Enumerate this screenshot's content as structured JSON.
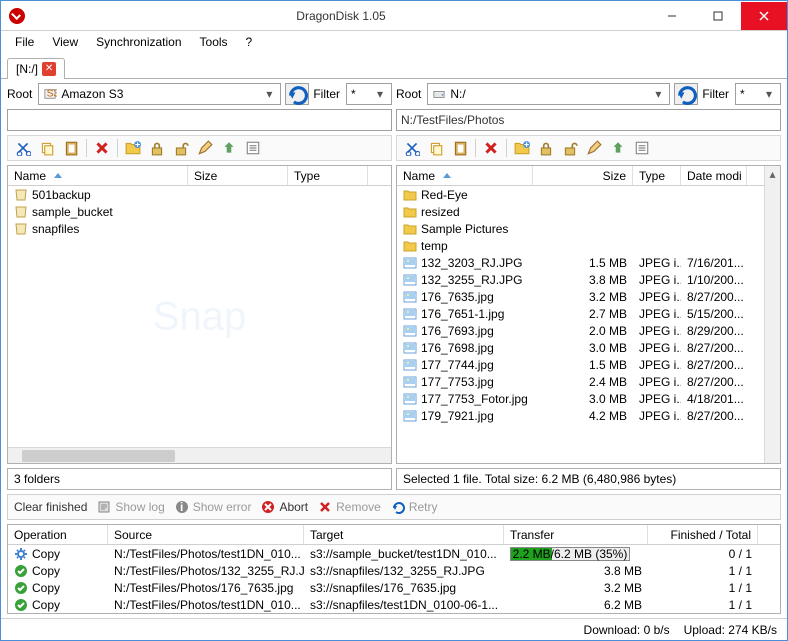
{
  "window": {
    "title": "DragonDisk 1.05"
  },
  "menu": [
    "File",
    "View",
    "Synchronization",
    "Tools",
    "?"
  ],
  "tabs": [
    {
      "label": "[N:/]"
    }
  ],
  "left": {
    "root_label": "Root",
    "root_value": "Amazon S3",
    "root_icon": "s3",
    "filter_label": "Filter",
    "filter_value": "*",
    "path": "",
    "columns": [
      "Name",
      "Size",
      "Type"
    ],
    "sort_col": 0,
    "items": [
      {
        "icon": "bucket",
        "name": "501backup"
      },
      {
        "icon": "bucket",
        "name": "sample_bucket"
      },
      {
        "icon": "bucket",
        "name": "snapfiles"
      }
    ],
    "status": "3 folders"
  },
  "right": {
    "root_label": "Root",
    "root_value": "N:/",
    "root_icon": "drive",
    "filter_label": "Filter",
    "filter_value": "*",
    "path": "N:/TestFiles/Photos",
    "columns": [
      "Name",
      "Size",
      "Type",
      "Date modi"
    ],
    "sort_col": 0,
    "items": [
      {
        "icon": "folder",
        "name": "Red-Eye"
      },
      {
        "icon": "folder",
        "name": "resized"
      },
      {
        "icon": "folder",
        "name": "Sample Pictures"
      },
      {
        "icon": "folder",
        "name": "temp"
      },
      {
        "icon": "image",
        "name": "132_3203_RJ.JPG",
        "size": "1.5 MB",
        "type": "JPEG i...",
        "date": "7/16/201..."
      },
      {
        "icon": "image",
        "name": "132_3255_RJ.JPG",
        "size": "3.8 MB",
        "type": "JPEG i...",
        "date": "1/10/200..."
      },
      {
        "icon": "image",
        "name": "176_7635.jpg",
        "size": "3.2 MB",
        "type": "JPEG i...",
        "date": "8/27/200..."
      },
      {
        "icon": "image",
        "name": "176_7651-1.jpg",
        "size": "2.7 MB",
        "type": "JPEG i...",
        "date": "5/15/200..."
      },
      {
        "icon": "image",
        "name": "176_7693.jpg",
        "size": "2.0 MB",
        "type": "JPEG i...",
        "date": "8/29/200..."
      },
      {
        "icon": "image",
        "name": "176_7698.jpg",
        "size": "3.0 MB",
        "type": "JPEG i...",
        "date": "8/27/200..."
      },
      {
        "icon": "image",
        "name": "177_7744.jpg",
        "size": "1.5 MB",
        "type": "JPEG i...",
        "date": "8/27/200..."
      },
      {
        "icon": "image",
        "name": "177_7753.jpg",
        "size": "2.4 MB",
        "type": "JPEG i...",
        "date": "8/27/200..."
      },
      {
        "icon": "image",
        "name": "177_7753_Fotor.jpg",
        "size": "3.0 MB",
        "type": "JPEG i...",
        "date": "4/18/201..."
      },
      {
        "icon": "image",
        "name": "179_7921.jpg",
        "size": "4.2 MB",
        "type": "JPEG i...",
        "date": "8/27/200..."
      }
    ],
    "status": "Selected 1 file. Total size: 6.2 MB (6,480,986 bytes)"
  },
  "transfer_toolbar": {
    "clear": "Clear finished",
    "showlog": "Show log",
    "showerr": "Show error",
    "abort": "Abort",
    "remove": "Remove",
    "retry": "Retry"
  },
  "transfers": {
    "columns": [
      "Operation",
      "Source",
      "Target",
      "Transfer",
      "Finished / Total"
    ],
    "rows": [
      {
        "status": "running",
        "op": "Copy",
        "src": "N:/TestFiles/Photos/test1DN_010...",
        "tgt": "s3://sample_bucket/test1DN_010...",
        "transfer": "2.2 MB/6.2 MB  (35%)",
        "percent": 35,
        "fin": "0 / 1"
      },
      {
        "status": "done",
        "op": "Copy",
        "src": "N:/TestFiles/Photos/132_3255_RJ.J...",
        "tgt": "s3://snapfiles/132_3255_RJ.JPG",
        "transfer": "3.8 MB",
        "fin": "1 / 1"
      },
      {
        "status": "done",
        "op": "Copy",
        "src": "N:/TestFiles/Photos/176_7635.jpg",
        "tgt": "s3://snapfiles/176_7635.jpg",
        "transfer": "3.2 MB",
        "fin": "1 / 1"
      },
      {
        "status": "done",
        "op": "Copy",
        "src": "N:/TestFiles/Photos/test1DN_010...",
        "tgt": "s3://snapfiles/test1DN_0100-06-1...",
        "transfer": "6.2 MB",
        "fin": "1 / 1"
      }
    ]
  },
  "statusbar": {
    "down": "Download: 0 b/s",
    "up": "Upload: 274 KB/s"
  }
}
